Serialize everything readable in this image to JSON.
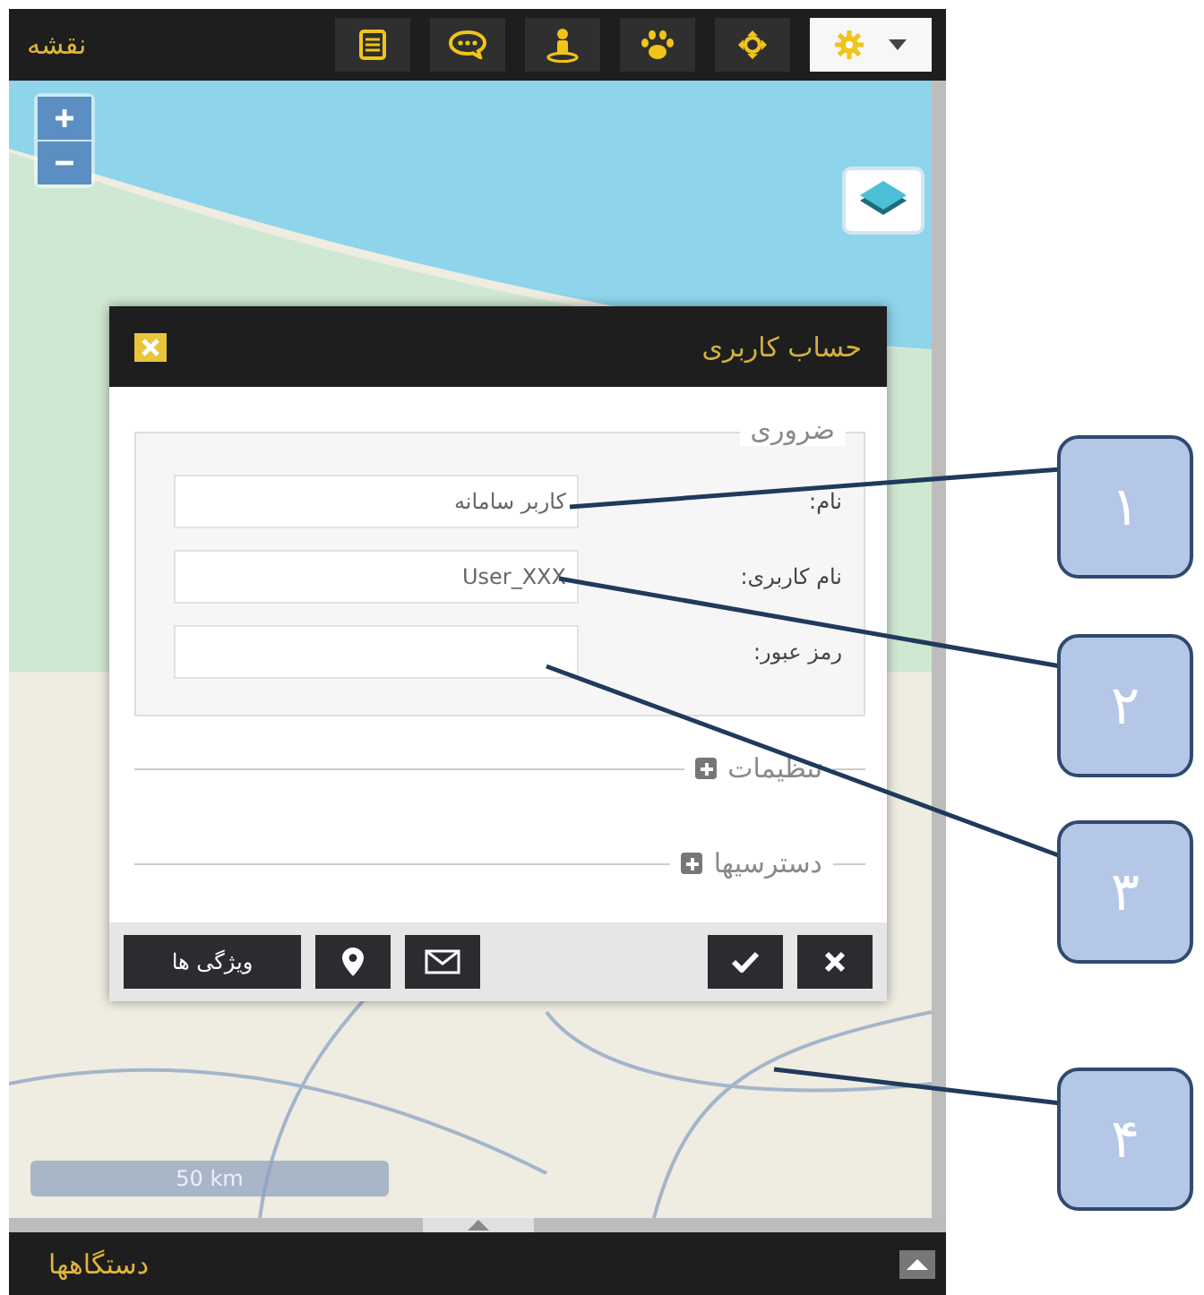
{
  "top_bar": {
    "title": "نقشه"
  },
  "map": {
    "scale_label": "50 km"
  },
  "dialog": {
    "title": "حساب کاربری",
    "legend": "ضروری",
    "fields": [
      {
        "label": "نام:",
        "value": "کاربر سامانه"
      },
      {
        "label": "نام کاربری:",
        "value": "User_XXX"
      },
      {
        "label": "رمز عبور:"
      }
    ],
    "sections": [
      {
        "label": "تنظیمات",
        "expanded": false
      },
      {
        "label": "دسترسیها",
        "expanded": false
      }
    ],
    "features_button": "ویژگی ها"
  },
  "bottom_bar": {
    "title": "دستگاهها"
  },
  "callouts": [
    {
      "number": "۱"
    },
    {
      "number": "۲"
    },
    {
      "number": "۳"
    },
    {
      "number": "۴"
    }
  ]
}
